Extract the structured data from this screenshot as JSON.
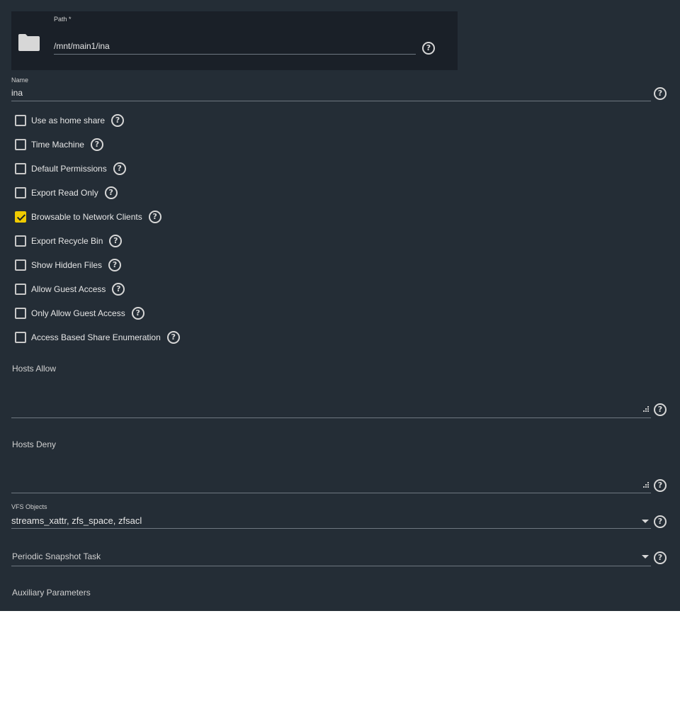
{
  "path_field": {
    "label": "Path *",
    "value": "/mnt/main1/ina",
    "icon": "folder-icon"
  },
  "name_field": {
    "label": "Name",
    "value": "ina"
  },
  "checkboxes": [
    {
      "label": "Use as home share",
      "checked": false
    },
    {
      "label": "Time Machine",
      "checked": false
    },
    {
      "label": "Default Permissions",
      "checked": false
    },
    {
      "label": "Export Read Only",
      "checked": false
    },
    {
      "label": "Browsable to Network Clients",
      "checked": true
    },
    {
      "label": "Export Recycle Bin",
      "checked": false
    },
    {
      "label": "Show Hidden Files",
      "checked": false
    },
    {
      "label": "Allow Guest Access",
      "checked": false
    },
    {
      "label": "Only Allow Guest Access",
      "checked": false
    },
    {
      "label": "Access Based Share Enumeration",
      "checked": false
    }
  ],
  "hosts_allow": {
    "label": "Hosts Allow",
    "value": ""
  },
  "hosts_deny": {
    "label": "Hosts Deny",
    "value": ""
  },
  "vfs_objects": {
    "label": "VFS Objects",
    "value": "streams_xattr, zfs_space, zfsacl"
  },
  "periodic_snapshot": {
    "placeholder": "Periodic Snapshot Task"
  },
  "auxiliary": {
    "label": "Auxiliary Parameters"
  },
  "colors": {
    "panel_bg": "#242d36",
    "path_bg": "#1a2028",
    "accent": "#f0cb00"
  }
}
